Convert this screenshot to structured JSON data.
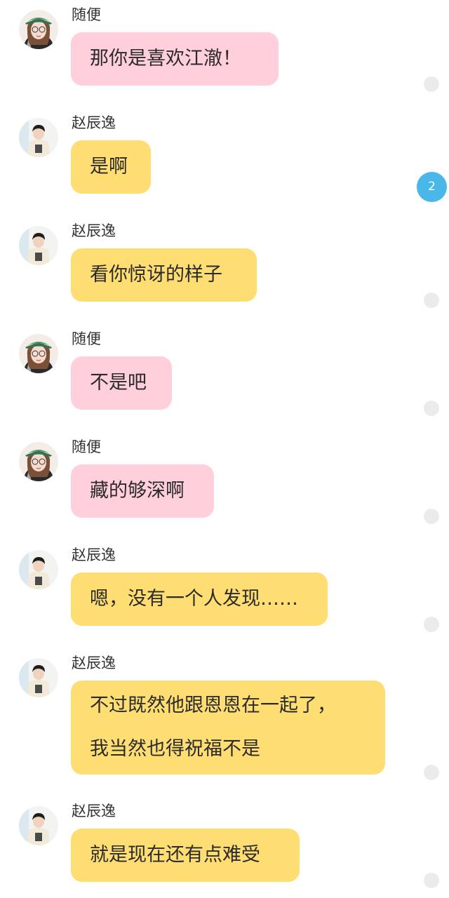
{
  "chat": {
    "messages": [
      {
        "sender": "随便",
        "lines": [
          "那你是喜欢江澈！"
        ]
      },
      {
        "sender": "赵辰逸",
        "lines": [
          "是啊"
        ]
      },
      {
        "sender": "赵辰逸",
        "lines": [
          "看你惊讶的样子"
        ]
      },
      {
        "sender": "随便",
        "lines": [
          "不是吧"
        ]
      },
      {
        "sender": "随便",
        "lines": [
          "藏的够深啊"
        ]
      },
      {
        "sender": "赵辰逸",
        "lines": [
          "嗯，没有一个人发现……"
        ]
      },
      {
        "sender": "赵辰逸",
        "lines": [
          "不过既然他跟恩恩在一起了，",
          "我当然也得祝福不是"
        ]
      },
      {
        "sender": "赵辰逸",
        "lines": [
          "就是现在还有点难受"
        ]
      }
    ],
    "unread_badge": "2"
  },
  "colors": {
    "pink_bubble": "#ffcfdc",
    "yellow_bubble": "#fedd72",
    "badge": "#4ab7e9",
    "dot": "#ebebeb"
  },
  "icons": {
    "girl_avatar": "girl-avatar-icon",
    "boy_avatar": "boy-avatar-icon"
  }
}
